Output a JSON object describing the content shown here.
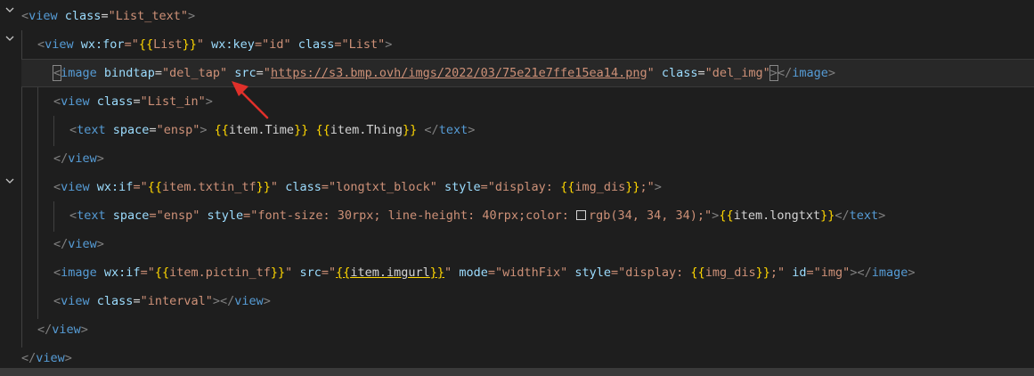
{
  "annotation": {
    "color": "#e0302a"
  },
  "lines": {
    "l1": {
      "p1": "<",
      "tag": "view",
      "sp": " ",
      "attr": "class",
      "eq": "=",
      "str": "\"List_text\"",
      "p2": ">"
    },
    "l2": {
      "p1": "<",
      "tag": "view",
      "a1": "wx:for",
      "s1q1": "=\"",
      "m1o": "{{",
      "m1v": "List",
      "m1c": "}}",
      "s1q2": "\"",
      "a2": "wx:key",
      "s2": "=\"id\"",
      "a3": "class",
      "s3": "=\"List\"",
      "p2": ">"
    },
    "l3": {
      "p1": "<",
      "tag": "image",
      "a1": "bindtap",
      "eq1": "=",
      "s1": "\"del_tap\"",
      "a2": "src",
      "eq2": "=",
      "q1": "\"",
      "url": "https://s3.bmp.ovh/imgs/2022/03/75e21e7ffe15ea14.png",
      "q2": "\"",
      "a3": "class",
      "eq3": "=",
      "s3": "\"del_img\"",
      "p2": ">",
      "close_open": "</",
      "ctag": "image",
      "close_end": ">"
    },
    "l4": {
      "p1": "<",
      "tag": "view",
      "attr": "class",
      "eq": "=",
      "str": "\"List_in\"",
      "p2": ">"
    },
    "l5": {
      "p1": "<",
      "tag": "text",
      "attr": "space",
      "eq": "=",
      "str": "\"ensp\"",
      "p2": ">",
      "m1o": "{{",
      "m1v": "item.Time",
      "m1c": "}}",
      "m2o": "{{",
      "m2v": "item.Thing",
      "m2c": "}}",
      "close_open": "</",
      "ctag": "text",
      "close_end": ">"
    },
    "l6": {
      "p1": "</",
      "tag": "view",
      "p2": ">"
    },
    "l7": {
      "p1": "<",
      "tag": "view",
      "a1": "wx:if",
      "s1q1": "=\"",
      "m1o": "{{",
      "m1v": "item.txtin_tf",
      "m1c": "}}",
      "s1q2": "\"",
      "a2": "class",
      "s2": "=\"longtxt_block\"",
      "a3": "style",
      "s3a": "=\"display: ",
      "m2o": "{{",
      "m2v": "img_dis",
      "m2c": "}}",
      "s3b": ";\"",
      "p2": ">"
    },
    "l8": {
      "p1": "<",
      "tag": "text",
      "a1": "space",
      "s1": "=\"ensp\"",
      "a2": "style",
      "s2a": "=\"font-size: 30rpx; line-height: 40rpx;color: ",
      "s2b": "rgb(34, 34, 34);\"",
      "p2": ">",
      "m1o": "{{",
      "m1v": "item.longtxt",
      "m1c": "}}",
      "close_open": "</",
      "ctag": "text",
      "close_end": ">"
    },
    "l9": {
      "p1": "</",
      "tag": "view",
      "p2": ">"
    },
    "l10": {
      "p1": "<",
      "tag": "image",
      "a1": "wx:if",
      "s1q1": "=\"",
      "m1o": "{{",
      "m1v": "item.pictin_tf",
      "m1c": "}}",
      "s1q2": "\"",
      "a2": "src",
      "s2q1": "=\"",
      "m2o": "{{",
      "m2v": "item.imgurl",
      "m2c": "}}",
      "s2q2": "\"",
      "a3": "mode",
      "s3": "=\"widthFix\"",
      "a4": "style",
      "s4a": "=\"display: ",
      "m3o": "{{",
      "m3v": "img_dis",
      "m3c": "}}",
      "s4b": ";\"",
      "a5": "id",
      "s5": "=\"img\"",
      "p2": ">",
      "close_open": "</",
      "ctag": "image",
      "close_end": ">"
    },
    "l11": {
      "p1": "<",
      "tag": "view",
      "attr": "class",
      "eq": "=",
      "str": "\"interval\"",
      "p2": ">",
      "close_open": "</",
      "ctag": "view",
      "close_end": ">"
    },
    "l12": {
      "p1": "</",
      "tag": "view",
      "p2": ">"
    },
    "l13": {
      "p1": "</",
      "tag": "view",
      "p2": ">"
    }
  }
}
